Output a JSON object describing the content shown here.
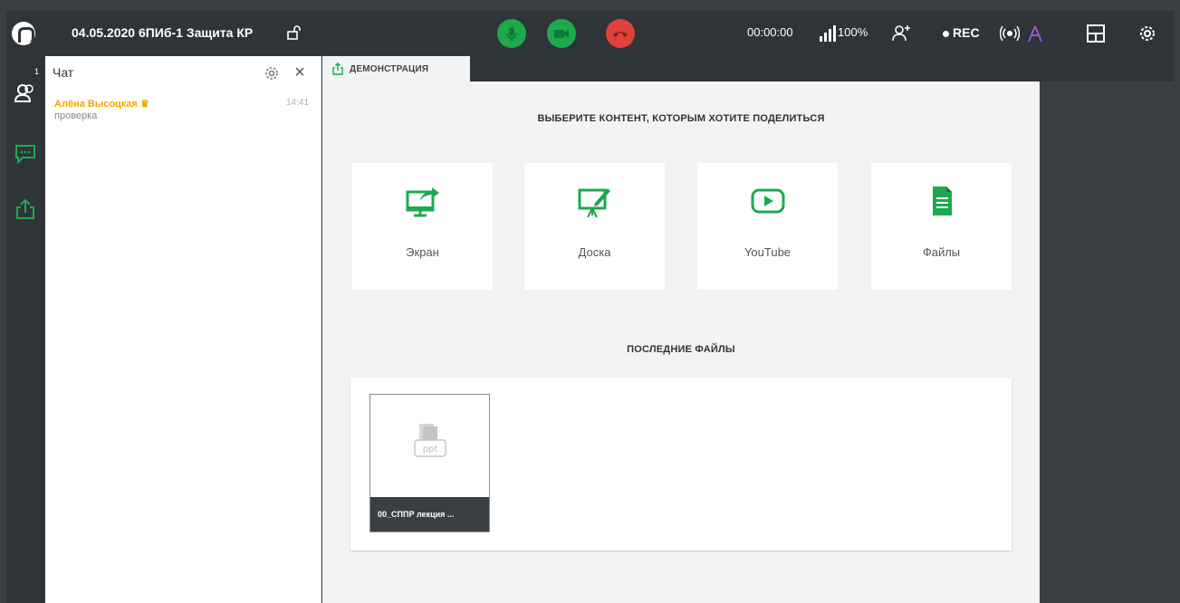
{
  "header": {
    "title": "04.05.2020 6ПИб-1 Защита КР",
    "timer": "00:00:00",
    "signal": "100%",
    "rec_label": "REC"
  },
  "rail": {
    "participants_count": "1"
  },
  "chat": {
    "title": "Чат",
    "messages": [
      {
        "author": "Алёна Высоцкая",
        "time": "14:41",
        "text": "проверка"
      }
    ]
  },
  "tabs": [
    {
      "label": "ДЕМОНСТРАЦИЯ"
    }
  ],
  "main": {
    "heading": "ВЫБЕРИТЕ КОНТЕНТ, КОТОРЫМ ХОТИТЕ ПОДЕЛИТЬСЯ",
    "cards": [
      {
        "label": "Экран",
        "icon": "screen-share-icon"
      },
      {
        "label": "Доска",
        "icon": "whiteboard-icon"
      },
      {
        "label": "YouTube",
        "icon": "youtube-icon"
      },
      {
        "label": "Файлы",
        "icon": "files-icon"
      }
    ],
    "recent_heading": "ПОСЛЕДНИЕ ФАЙЛЫ",
    "recent_files": [
      {
        "name": "00_СППР лекция ...",
        "type": "ppt"
      }
    ]
  },
  "colors": {
    "accent": "#1fa94e",
    "danger": "#e0413b",
    "author": "#f0a800",
    "dark": "#2f3438"
  }
}
